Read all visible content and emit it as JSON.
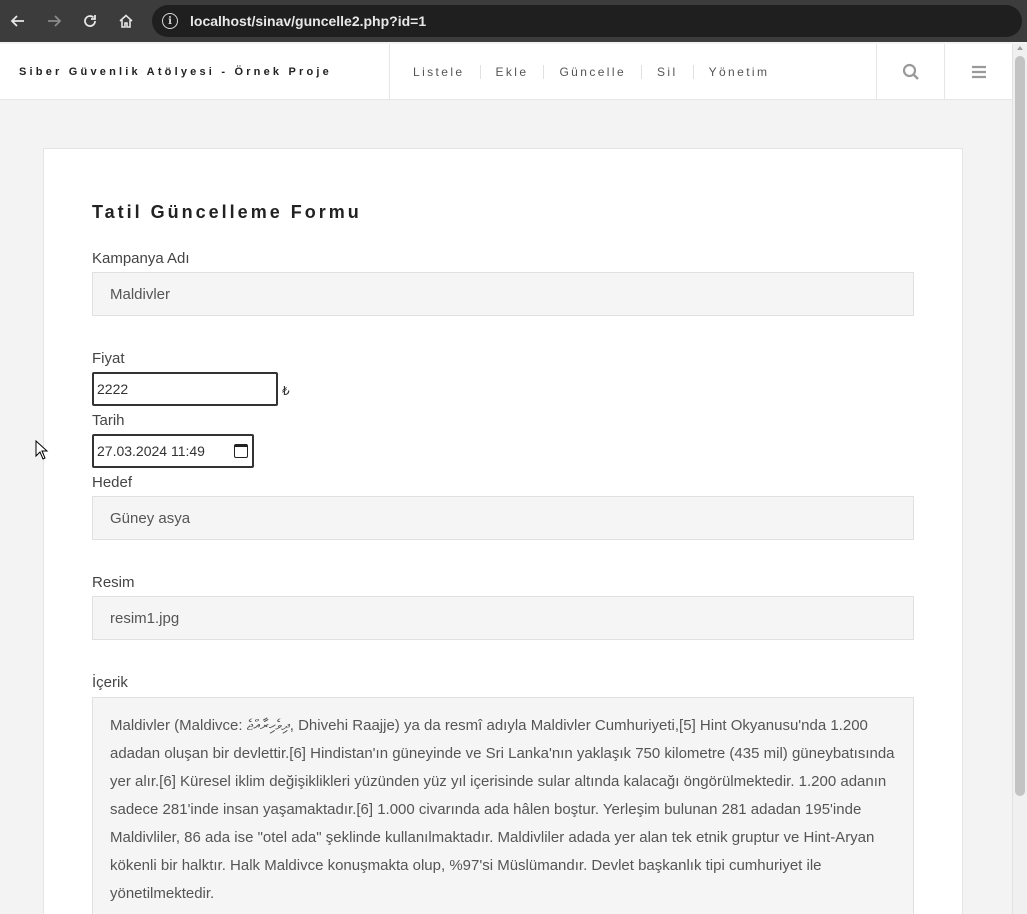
{
  "browser": {
    "url": "localhost/sinav/guncelle2.php?id=1"
  },
  "site": {
    "brand": "Siber Güvenlik Atölyesi - Örnek Proje",
    "menu": [
      "Listele",
      "Ekle",
      "Güncelle",
      "Sil",
      "Yönetim"
    ]
  },
  "form": {
    "title": "Tatil Güncelleme Formu",
    "kampanya_label": "Kampanya Adı",
    "kampanya_value": "Maldivler",
    "fiyat_label": "Fiyat",
    "fiyat_value": "2222",
    "currency": "₺",
    "tarih_label": "Tarih",
    "tarih_value": "27.03.2024 11:49",
    "hedef_label": "Hedef",
    "hedef_value": "Güney asya",
    "resim_label": "Resim",
    "resim_value": "resim1.jpg",
    "icerik_label": "İçerik",
    "icerik_value": "Maldivler (Maldivce: ދިވެހިރާއްޖެ, Dhivehi Raajje) ya da resmî adıyla Maldivler Cumhuriyeti,[5] Hint Okyanusu'nda 1.200 adadan oluşan bir devlettir.[6] Hindistan'ın güneyinde ve Sri Lanka'nın yaklaşık 750 kilometre (435 mil) güneybatısında yer alır.[6] Küresel iklim değişiklikleri yüzünden yüz yıl içerisinde sular altında kalacağı öngörülmektedir.  1.200 adanın sadece 281'inde insan yaşamaktadır.[6] 1.000 civarında ada hâlen boştur. Yerleşim bulunan 281 adadan 195'inde Maldivliler, 86 ada ise \"otel ada\" şeklinde kullanılmaktadır. Maldivliler adada yer alan tek etnik gruptur ve Hint-Aryan kökenli bir halktır. Halk Maldivce konuşmakta olup, %97'si Müslümandır. Devlet başkanlık tipi cumhuriyet ile yönetilmektedir."
  },
  "icons": [
    "back-icon",
    "forward-icon",
    "reload-icon",
    "home-icon",
    "info-icon",
    "search-icon",
    "hamburger-icon",
    "calendar-icon",
    "mouse-cursor-icon"
  ]
}
